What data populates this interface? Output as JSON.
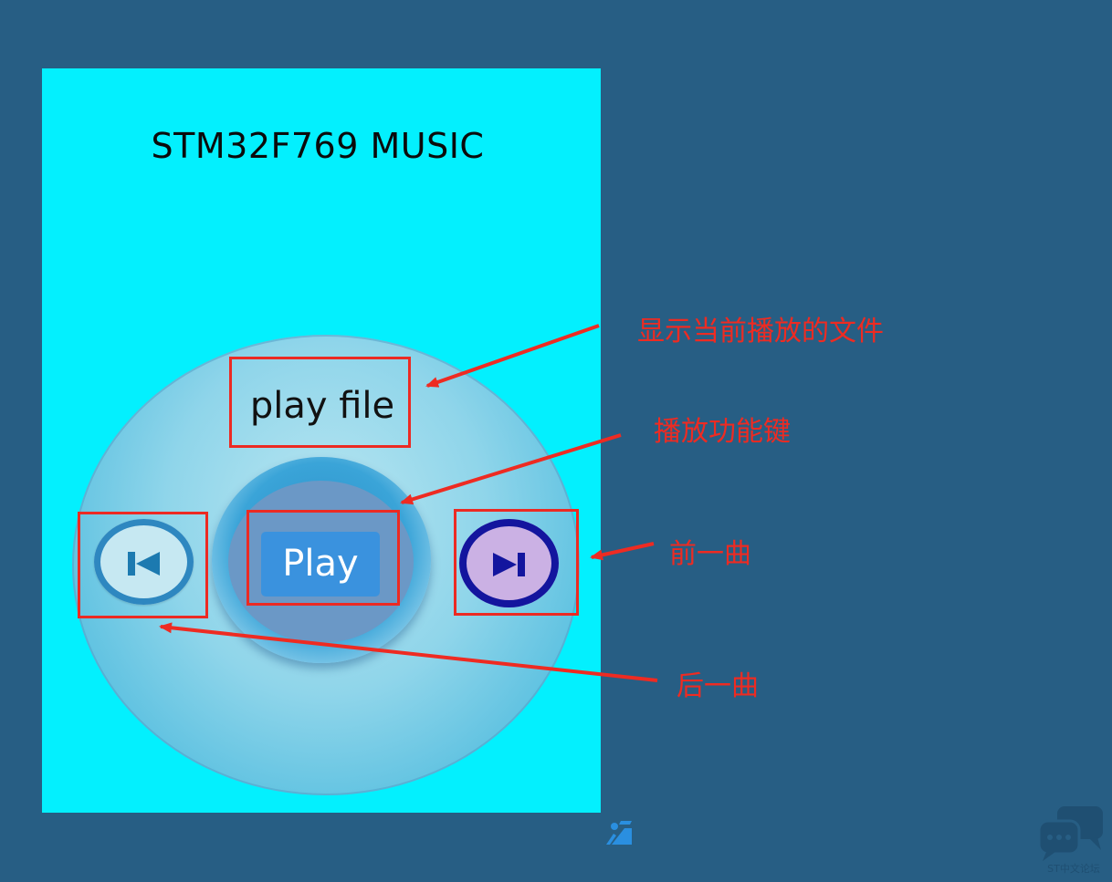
{
  "app": {
    "title": "STM32F769 MUSIC",
    "play_file_label": "play file",
    "play_button_label": "Play"
  },
  "annotations": {
    "current_file": "显示当前播放的文件",
    "play_key": "播放功能键",
    "prev_track": "前一曲",
    "next_track": "后一曲"
  },
  "icons": {
    "prev": "skip-previous-icon",
    "next": "skip-next-icon",
    "page_logo": "logo-icon",
    "forum": "chat-bubbles-icon"
  },
  "watermark": {
    "forum_name": "ST中文论坛"
  },
  "colors": {
    "background": "#275e84",
    "screen": "#03f0fe",
    "annotation": "#ee2b22",
    "play_button": "#3a92de"
  }
}
